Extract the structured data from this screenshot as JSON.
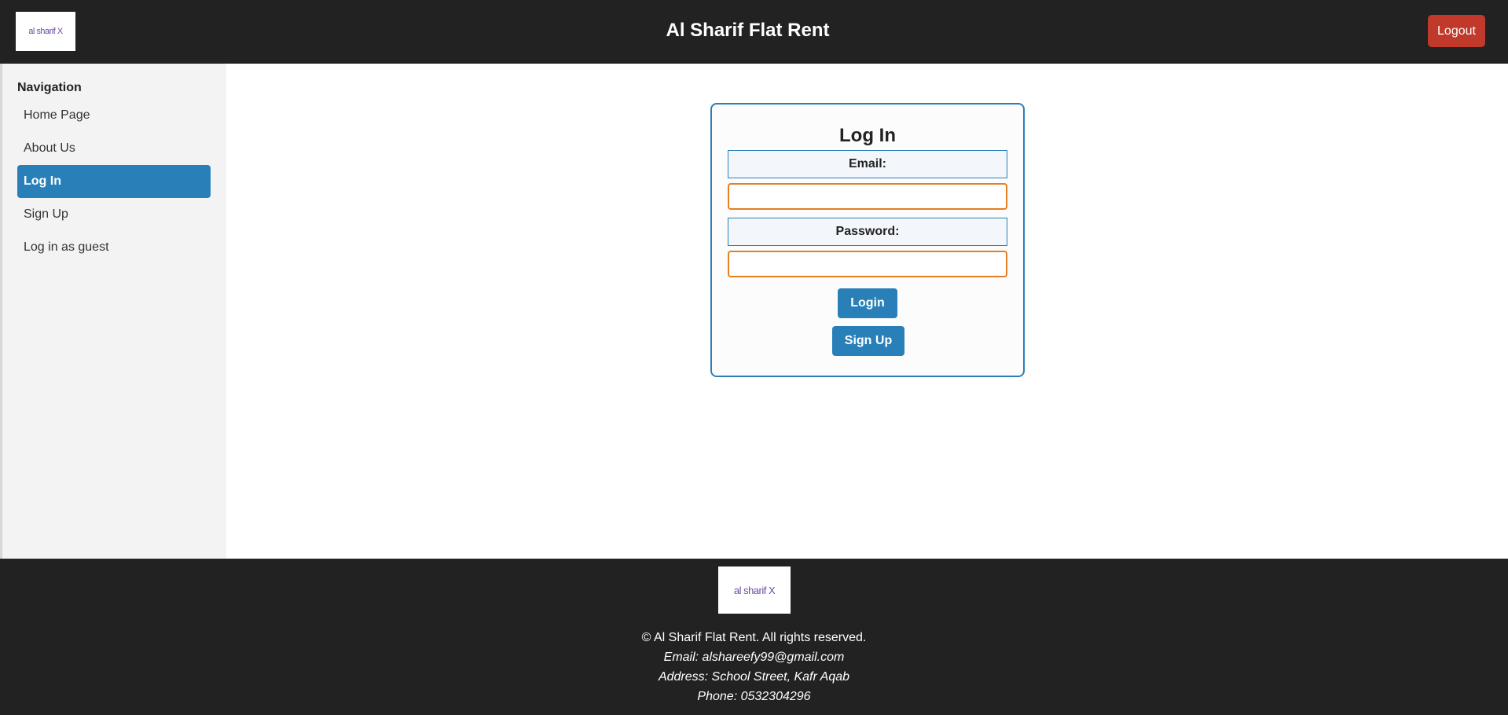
{
  "header": {
    "logo_text": "al sharif X",
    "title": "Al Sharif Flat Rent",
    "logout_label": "Logout"
  },
  "sidebar": {
    "title": "Navigation",
    "items": [
      {
        "label": "Home Page",
        "active": false
      },
      {
        "label": "About Us",
        "active": false
      },
      {
        "label": "Log In",
        "active": true
      },
      {
        "label": "Sign Up",
        "active": false
      },
      {
        "label": "Log in as guest",
        "active": false
      }
    ]
  },
  "login": {
    "title": "Log In",
    "email_label": "Email:",
    "email_value": "",
    "password_label": "Password:",
    "password_value": "",
    "login_button": "Login",
    "signup_button": "Sign Up"
  },
  "footer": {
    "logo_text": "al sharif X",
    "copyright": "© Al Sharif Flat Rent. All rights reserved.",
    "email": "Email: alshareefy99@gmail.com",
    "address": "Address: School Street, Kafr Aqab",
    "phone": "Phone: 0532304296"
  },
  "colors": {
    "header_bg": "#222222",
    "accent": "#2980b9",
    "logout": "#c0392b",
    "input_border": "#e67e22",
    "sidebar_bg": "#f3f3f3"
  }
}
